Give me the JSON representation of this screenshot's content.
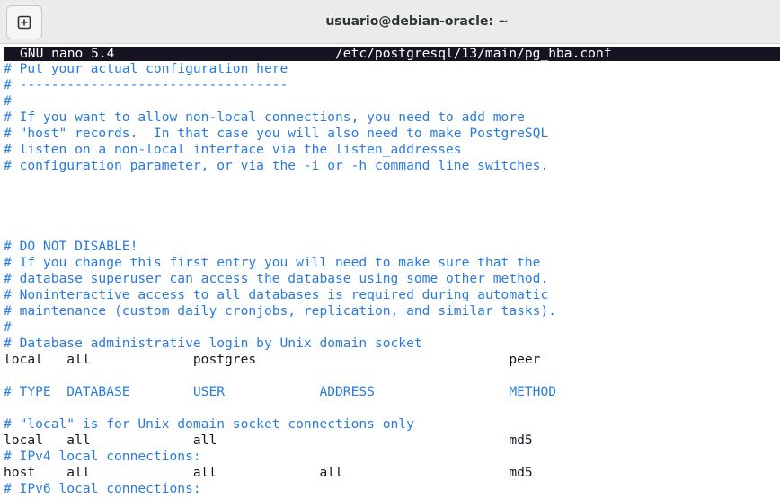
{
  "window": {
    "title": "usuario@debian-oracle: ~",
    "new_tab_icon": "new-tab-icon"
  },
  "nano": {
    "version": "GNU nano 5.4",
    "file_path": "/etc/postgresql/13/main/pg_hba.conf"
  },
  "colors": {
    "comment": "#2a7bde",
    "code": "#171421",
    "status_bar_bg": "#171421",
    "titlebar_bg": "#ebebeb"
  },
  "lines": [
    {
      "text": "# Put your actual configuration here",
      "type": "comment"
    },
    {
      "text": "# ----------------------------------",
      "type": "comment"
    },
    {
      "text": "#",
      "type": "comment"
    },
    {
      "text": "# If you want to allow non-local connections, you need to add more",
      "type": "comment"
    },
    {
      "text": "# \"host\" records.  In that case you will also need to make PostgreSQL",
      "type": "comment"
    },
    {
      "text": "# listen on a non-local interface via the listen_addresses",
      "type": "comment"
    },
    {
      "text": "# configuration parameter, or via the -i or -h command line switches.",
      "type": "comment"
    },
    {
      "text": "",
      "type": "blank"
    },
    {
      "text": "",
      "type": "blank"
    },
    {
      "text": "",
      "type": "blank"
    },
    {
      "text": "",
      "type": "blank"
    },
    {
      "text": "# DO NOT DISABLE!",
      "type": "comment"
    },
    {
      "text": "# If you change this first entry you will need to make sure that the",
      "type": "comment"
    },
    {
      "text": "# database superuser can access the database using some other method.",
      "type": "comment"
    },
    {
      "text": "# Noninteractive access to all databases is required during automatic",
      "type": "comment"
    },
    {
      "text": "# maintenance (custom daily cronjobs, replication, and similar tasks).",
      "type": "comment"
    },
    {
      "text": "#",
      "type": "comment"
    },
    {
      "text": "# Database administrative login by Unix domain socket",
      "type": "comment"
    },
    {
      "text": "local   all             postgres                                peer",
      "type": "code"
    },
    {
      "text": "",
      "type": "blank"
    },
    {
      "text": "# TYPE  DATABASE        USER            ADDRESS                 METHOD",
      "type": "comment"
    },
    {
      "text": "",
      "type": "blank"
    },
    {
      "text": "# \"local\" is for Unix domain socket connections only",
      "type": "comment"
    },
    {
      "text": "local   all             all                                     md5",
      "type": "code"
    },
    {
      "text": "# IPv4 local connections:",
      "type": "comment"
    },
    {
      "text": "host    all             all             all                     md5",
      "type": "code"
    },
    {
      "text": "# IPv6 local connections:",
      "type": "comment"
    }
  ]
}
